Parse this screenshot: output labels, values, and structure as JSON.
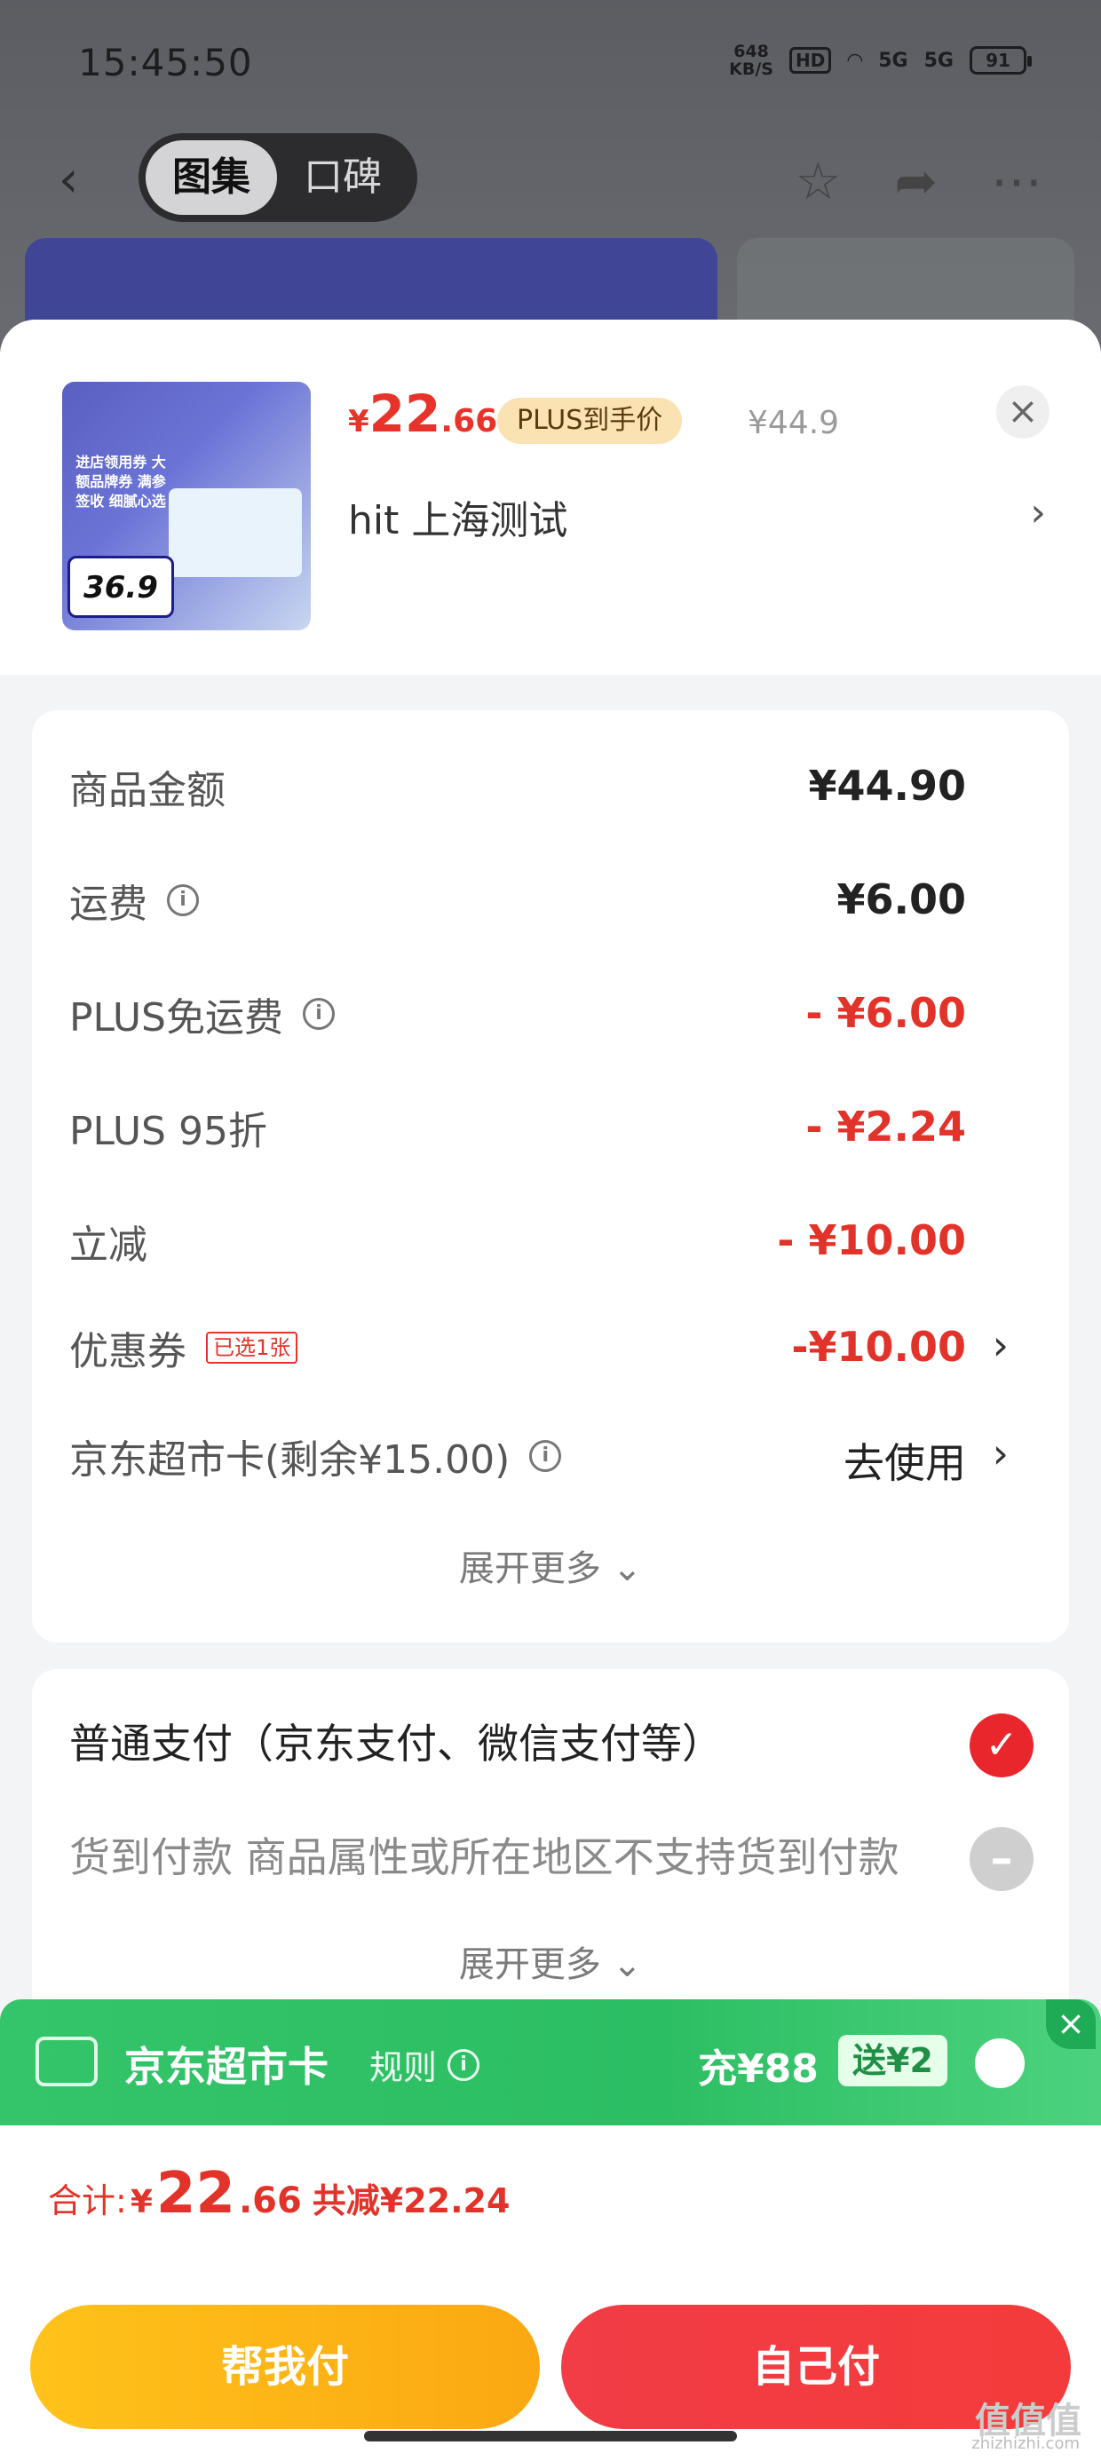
{
  "status": {
    "time": "15:45:50",
    "netspeed_value": "648",
    "netspeed_unit": "KB/S",
    "hd": "HD",
    "sig1": "5G",
    "sig2": "5G",
    "battery": "91"
  },
  "nav": {
    "tab_gallery": "图集",
    "tab_reviews": "口碑"
  },
  "product": {
    "thumb_text": "进店领用券 大额品牌券 满参签收 细腻心选",
    "thumb_price": "36.9",
    "price_symbol": "¥",
    "price_int": "22",
    "price_dec": ".66",
    "plus_label": "PLUS到手价",
    "original_price": "¥44.9",
    "store_name": "hit  上海测试"
  },
  "summary": {
    "rows": [
      {
        "label": "商品金额",
        "value": "¥44.90"
      },
      {
        "label": "运费",
        "value": "¥6.00"
      },
      {
        "label": "PLUS免运费",
        "value": "- ¥6.00"
      },
      {
        "label": "PLUS 95折",
        "value": "- ¥2.24"
      },
      {
        "label": "立减",
        "value": "- ¥10.00"
      },
      {
        "label": "优惠券",
        "tag": "已选1张",
        "value": "-¥10.00"
      },
      {
        "label": "京东超市卡(剩余¥15.00)",
        "value": "去使用"
      }
    ],
    "expand": "展开更多 ⌄"
  },
  "payment": {
    "normal": "普通支付（京东支付、微信支付等）",
    "cod": "货到付款 商品属性或所在地区不支持货到付款",
    "expand": "展开更多 ⌄"
  },
  "promo": {
    "title": "京东超市卡",
    "rule": "规则",
    "recharge": "充¥88",
    "gift": "送¥2"
  },
  "footer": {
    "total_label": "合计:",
    "total_symbol": "¥",
    "total_int": "22",
    "total_dec": ".66",
    "total_save": "共减¥22.24",
    "btn_help": "帮我付",
    "btn_self": "自己付"
  },
  "watermark": {
    "logo": "值值值",
    "site": "zhizhizhi.com"
  },
  "colors": {
    "accent_red": "#e8262c",
    "promo_green": "#34c46a",
    "gold": "#ffc21a"
  }
}
